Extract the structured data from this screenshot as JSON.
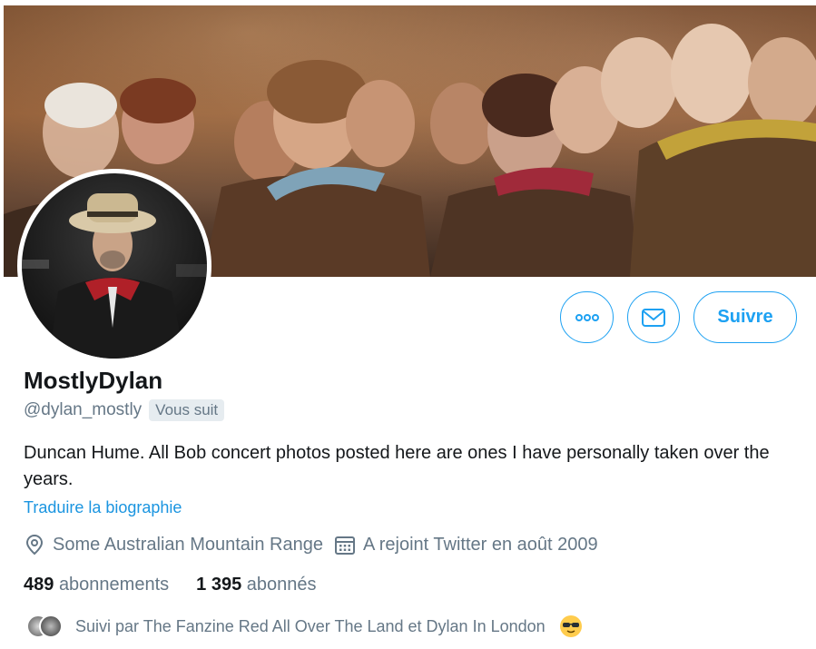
{
  "profile": {
    "display_name": "MostlyDylan",
    "handle": "@dylan_mostly",
    "follows_you_badge": "Vous suit",
    "bio": "Duncan Hume. All Bob concert photos posted here are ones I have personally taken over the years.",
    "translate_bio": "Traduire la biographie",
    "location": "Some Australian Mountain Range",
    "joined": "A rejoint Twitter en août 2009"
  },
  "stats": {
    "following_count": "489",
    "following_label": "abonnements",
    "followers_count": "1 395",
    "followers_label": "abonnés"
  },
  "followed_by": {
    "text": "Suivi par The Fanzine Red All Over The Land et Dylan In London",
    "emoji": "smiling-face-with-sunglasses"
  },
  "actions": {
    "more_icon": "more-dots-icon",
    "message_icon": "envelope-icon",
    "follow_label": "Suivre"
  },
  "colors": {
    "accent": "#1da1f2",
    "link": "#1b95e0",
    "secondary_text": "#657786",
    "primary_text": "#14171a",
    "badge_bg": "#e6ecf0"
  }
}
